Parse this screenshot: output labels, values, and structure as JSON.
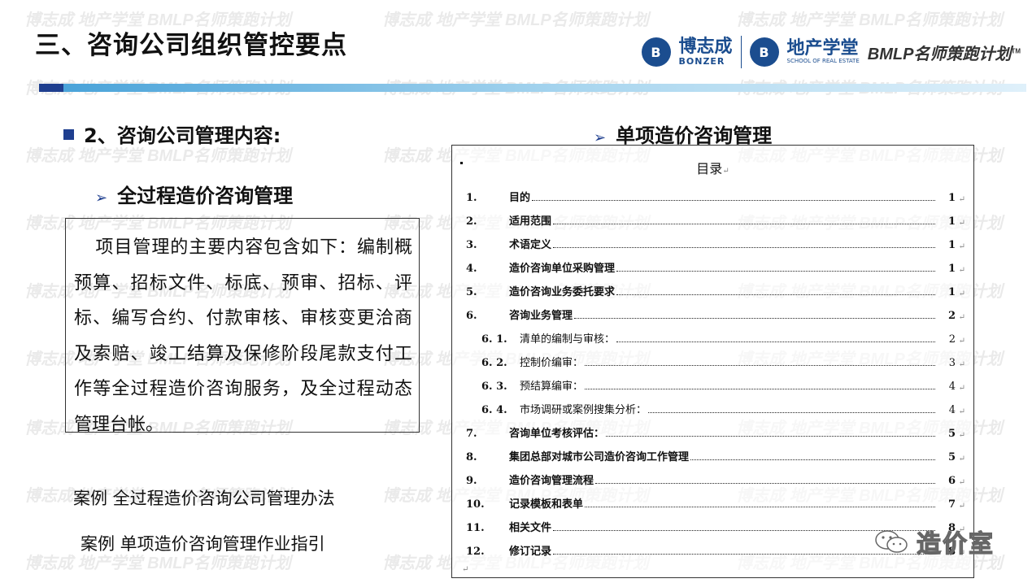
{
  "watermark": {
    "brand_cn": "博志成",
    "brand_en": "BONZER",
    "school_cn": "地产学堂",
    "bmlp": "BMLP名师策跑计划"
  },
  "slide": {
    "title": "三、咨询公司组织管控要点"
  },
  "logos": {
    "bonzer_mark": "B",
    "bonzer_cn": "博志成",
    "bonzer_en": "BONZER",
    "school_mark": "B",
    "school_cn": "地产学堂",
    "school_en": "SCHOOL OF REAL ESTATE",
    "bmlp": "BMLP名师策跑计划",
    "tm": "TM"
  },
  "left": {
    "heading": "2、咨询公司管理内容:",
    "subheading": "全过程造价咨询管理",
    "paragraph": "项目管理的主要内容包含如下：编制概预算、招标文件、标底、预审、招标、评标、编写合约、付款审核、审核变更洽商及索赔、竣工结算及保修阶段尾款支付工作等全过程造价咨询服务，及全过程动态管理台帐。",
    "case1": "案例 全过程造价咨询公司管理办法",
    "case2": "案例 单项造价咨询管理作业指引"
  },
  "right": {
    "heading": "单项造价咨询管理",
    "doc_title": "目录",
    "return_mark": "↵",
    "toc": [
      {
        "num": "1.",
        "label": "目的",
        "page": "1",
        "sub": false
      },
      {
        "num": "2.",
        "label": "适用范围",
        "page": "1",
        "sub": false
      },
      {
        "num": "3.",
        "label": "术语定义",
        "page": "1",
        "sub": false
      },
      {
        "num": "4.",
        "label": "造价咨询单位采购管理",
        "page": "1",
        "sub": false
      },
      {
        "num": "5.",
        "label": "造价咨询业务委托要求",
        "page": "1",
        "sub": false
      },
      {
        "num": "6.",
        "label": "咨询业务管理",
        "page": "2",
        "sub": false
      },
      {
        "num": "6. 1.",
        "label": "清单的编制与审核：",
        "page": "2",
        "sub": true
      },
      {
        "num": "6. 2.",
        "label": "控制价编审：",
        "page": "3",
        "sub": true
      },
      {
        "num": "6. 3.",
        "label": "预结算编审：",
        "page": "4",
        "sub": true
      },
      {
        "num": "6. 4.",
        "label": "市场调研或案例搜集分析：",
        "page": "4",
        "sub": true
      },
      {
        "num": "7.",
        "label": "咨询单位考核评估：",
        "page": "5",
        "sub": false
      },
      {
        "num": "8.",
        "label": "集团总部对城市公司造价咨询工作管理",
        "page": "5",
        "sub": false
      },
      {
        "num": "9.",
        "label": "造价咨询管理流程",
        "page": "6",
        "sub": false
      },
      {
        "num": "10.",
        "label": "记录模板和表单",
        "page": "7",
        "sub": false
      },
      {
        "num": "11.",
        "label": "相关文件",
        "page": "8",
        "sub": false
      },
      {
        "num": "12.",
        "label": "修订记录",
        "page": "8",
        "sub": false
      }
    ]
  },
  "wechat": {
    "label": "造价室"
  }
}
